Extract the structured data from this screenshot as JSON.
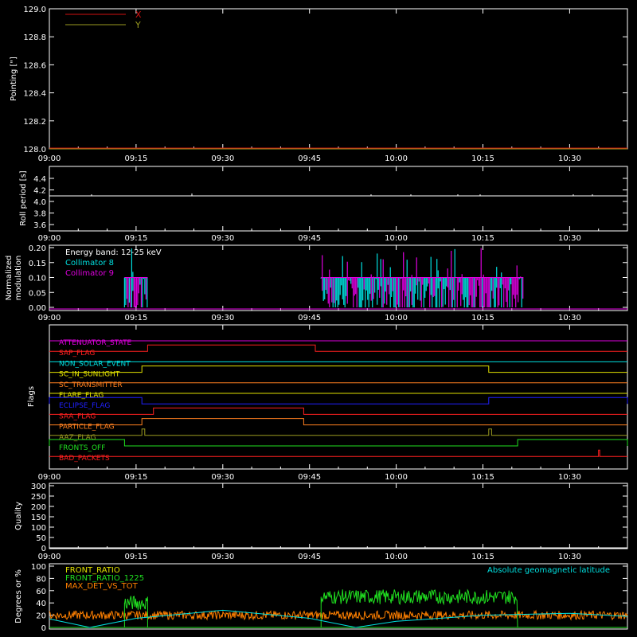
{
  "colors": {
    "background": "#000000",
    "axes": "#ffffff",
    "x": "#d01010",
    "y": "#9a9a20",
    "cyan": "#00e0e0",
    "magenta": "#e000e0",
    "green": "#20e020",
    "orange": "#ff8000"
  },
  "chart_data": [
    {
      "type": "line",
      "ylabel": "Pointing [\"]",
      "ylim": [
        128.0,
        129.0
      ],
      "yticks": [
        "128.0",
        "128.2",
        "128.4",
        "128.6",
        "128.8",
        "129.0"
      ],
      "xticks": [
        "09:00",
        "09:15",
        "09:30",
        "09:45",
        "10:00",
        "10:15",
        "10:30"
      ],
      "xlim_minutes_after_0900": [
        0,
        100
      ],
      "legend": "top-left",
      "series": [
        {
          "name": "X",
          "color": "#d01010",
          "values": [
            128.0,
            128.0
          ]
        },
        {
          "name": "Y",
          "color": "#9a9a20",
          "values": [
            128.0,
            128.0
          ]
        }
      ]
    },
    {
      "type": "line",
      "ylabel": "Roll period [s]",
      "ylim": [
        3.5,
        4.5
      ],
      "yticks": [
        "3.6",
        "3.8",
        "4.0",
        "4.2",
        "4.4"
      ],
      "xticks": [
        "09:00",
        "09:15",
        "09:30",
        "09:45",
        "10:00",
        "10:15",
        "10:30"
      ],
      "series": [
        {
          "values": [
            4.0,
            4.0
          ]
        }
      ]
    },
    {
      "type": "line",
      "ylabel": "Normalized modulation",
      "ylim": [
        0.0,
        0.2
      ],
      "yticks": [
        "0.00",
        "0.05",
        "0.10",
        "0.15",
        "0.20"
      ],
      "xticks": [
        "09:00",
        "09:15",
        "09:30",
        "09:45",
        "10:00",
        "10:15",
        "10:30"
      ],
      "annotation": "Energy band: 12-25 keV",
      "legend": "top-left",
      "series": [
        {
          "name": "Collimator 8",
          "color": "#00e0e0"
        },
        {
          "name": "Collimator 9",
          "color": "#e000e0"
        }
      ],
      "active_intervals": [
        [
          "09:13",
          "09:17"
        ],
        [
          "09:47",
          "10:22"
        ]
      ],
      "typical_value": 0.1
    },
    {
      "type": "line",
      "ylabel": "Flags",
      "xticks": [
        "09:00",
        "09:15",
        "09:30",
        "09:45",
        "10:00",
        "10:15",
        "10:30"
      ],
      "flags": [
        {
          "name": "ATTENUATOR_STATE",
          "color": "#e000e0",
          "on": []
        },
        {
          "name": "SAP_FLAG",
          "color": "#ff2020",
          "on": [
            [
              "09:17",
              "09:46"
            ]
          ]
        },
        {
          "name": "NON_SOLAR_EVENT",
          "color": "#00e0e0",
          "on": []
        },
        {
          "name": "SC_IN_SUNLIGHT",
          "color": "#e0e000",
          "on": [
            [
              "09:16",
              "10:16"
            ]
          ]
        },
        {
          "name": "SC_TRANSMITTER",
          "color": "#ff8020",
          "on": []
        },
        {
          "name": "FLARE_FLAG",
          "color": "#e0e000",
          "on": []
        },
        {
          "name": "ECLIPSE_FLAG",
          "color": "#2020ff",
          "on": [
            [
              "09:00",
              "09:16"
            ],
            [
              "10:16",
              "10:40"
            ]
          ]
        },
        {
          "name": "SAA_FLAG",
          "color": "#ff2020",
          "on": [
            [
              "09:18",
              "09:44"
            ]
          ]
        },
        {
          "name": "PARTICLE_FLAG",
          "color": "#ff8020",
          "on": [
            [
              "09:16",
              "09:44"
            ]
          ]
        },
        {
          "name": "AAZ_FLAG",
          "color": "#9a9a20",
          "on": [
            [
              "09:16",
              "09:16.5"
            ],
            [
              "10:16",
              "10:16.5"
            ]
          ]
        },
        {
          "name": "FRONTS_OFF",
          "color": "#20e020",
          "on": [
            [
              "09:00",
              "09:13"
            ],
            [
              "10:21",
              "10:40"
            ]
          ]
        },
        {
          "name": "BAD_PACKETS",
          "color": "#ff2020",
          "on": [
            [
              "10:35",
              "10:35.2"
            ]
          ]
        }
      ]
    },
    {
      "type": "line",
      "ylabel": "Quality",
      "ylim": [
        0,
        300
      ],
      "yticks": [
        "0",
        "50",
        "100",
        "150",
        "200",
        "250",
        "300"
      ],
      "xticks": [
        "09:00",
        "09:15",
        "09:30",
        "09:45",
        "10:00",
        "10:15",
        "10:30"
      ],
      "series": [
        {
          "values": [
            0,
            0
          ]
        }
      ]
    },
    {
      "type": "line",
      "ylabel": "Degrees or %",
      "ylim": [
        0,
        100
      ],
      "yticks": [
        "0",
        "20",
        "40",
        "60",
        "80",
        "100"
      ],
      "annotation": "Absolute geomagnetic latitude",
      "legend": "top-left",
      "series": [
        {
          "name": "FRONT_RATIO",
          "color": "#e0e000"
        },
        {
          "name": "FRONT_RATIO_1225",
          "color": "#20e020",
          "intervals": [
            [
              "09:13",
              "09:17",
              40
            ],
            [
              "09:47",
              "10:21",
              50
            ]
          ]
        },
        {
          "name": "MAX_DET_VS_TOT",
          "color": "#ff8000",
          "typical_value": 20
        }
      ],
      "latitude_curve": {
        "x": [
          "09:00",
          "09:07",
          "09:15",
          "09:30",
          "09:45",
          "09:53",
          "10:00",
          "10:15",
          "10:30",
          "10:40"
        ],
        "y": [
          14,
          0,
          15,
          28,
          15,
          0,
          10,
          20,
          23,
          18
        ]
      }
    }
  ]
}
